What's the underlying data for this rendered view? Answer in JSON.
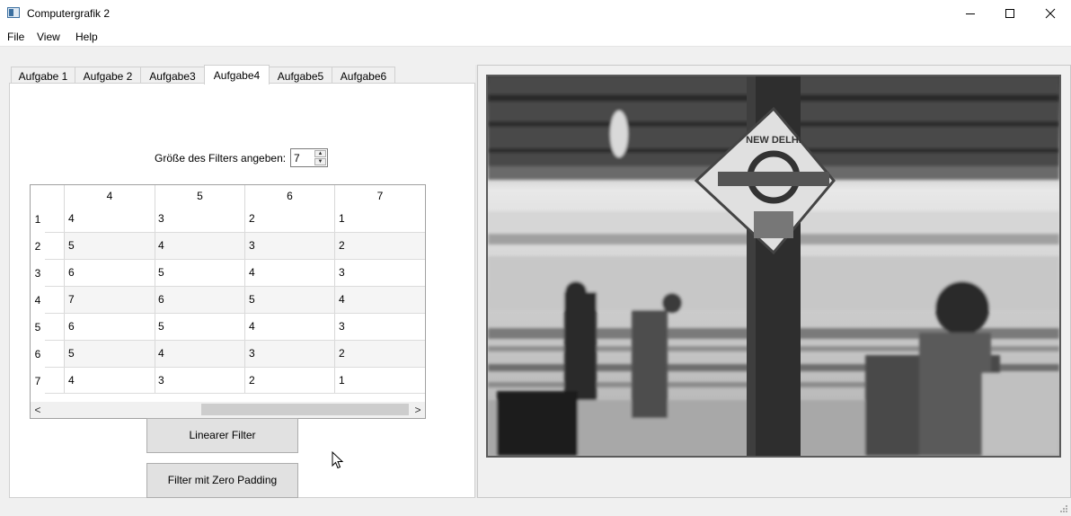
{
  "window": {
    "title": "Computergrafik 2",
    "controls": [
      "minimize-icon",
      "maximize-icon",
      "close-icon"
    ]
  },
  "menu": [
    "File",
    "View",
    "Help"
  ],
  "tabs": [
    {
      "label": "Aufgabe 1",
      "active": false
    },
    {
      "label": "Aufgabe 2",
      "active": false
    },
    {
      "label": "Aufgabe3",
      "active": false
    },
    {
      "label": "Aufgabe4",
      "active": true
    },
    {
      "label": "Aufgabe5",
      "active": false
    },
    {
      "label": "Aufgabe6",
      "active": false
    }
  ],
  "filter": {
    "label": "Größe des Filters angeben:",
    "size_value": "7"
  },
  "table": {
    "column_headers": [
      "4",
      "5",
      "6",
      "7"
    ],
    "row_headers": [
      "1",
      "2",
      "3",
      "4",
      "5",
      "6",
      "7"
    ],
    "rows": [
      [
        "4",
        "3",
        "2",
        "1"
      ],
      [
        "5",
        "4",
        "3",
        "2"
      ],
      [
        "6",
        "5",
        "4",
        "3"
      ],
      [
        "7",
        "6",
        "5",
        "4"
      ],
      [
        "6",
        "5",
        "4",
        "3"
      ],
      [
        "5",
        "4",
        "3",
        "2"
      ],
      [
        "4",
        "3",
        "2",
        "1"
      ]
    ],
    "scroll_left_icon": "<",
    "scroll_right_icon": ">"
  },
  "buttons": {
    "linear": "Linearer Filter",
    "zero_padding": "Filter mit Zero Padding"
  },
  "image": {
    "sign_text": "NEW DELHI"
  }
}
